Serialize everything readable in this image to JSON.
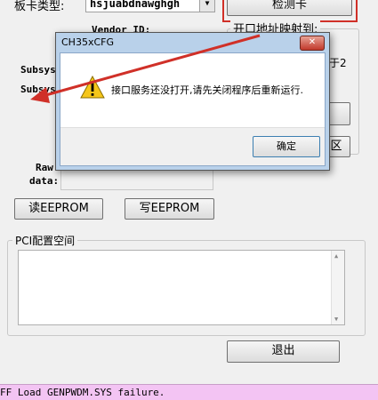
{
  "main": {
    "card_type_label": "板卡类型:",
    "card_type_value": "hsjuabdnawghgh",
    "detect_button": "检测卡",
    "vendor_id_label": "Vendor ID:",
    "subsys_label_1": "Subsys",
    "subsys_label_2": "Subsys",
    "port_map_group": "开口地址映射到:",
    "right_partial_text": "于2",
    "raw_label": "Raw",
    "data_label": "data:",
    "read_eeprom": "读EEPROM",
    "write_eeprom": "写EEPROM",
    "pci_group": "PCI配置空间",
    "exit_button": "退出",
    "partial_button_text": "区"
  },
  "dialog": {
    "title": "CH35xCFG",
    "close_glyph": "✕",
    "message": "接口服务还没打开,请先关闭程序后重新运行.",
    "ok_button": "确定",
    "icon": "warning-icon"
  },
  "status_bar": {
    "text": "FF Load GENPWDM.SYS failure."
  },
  "colors": {
    "annotation_arrow": "#d03028",
    "annotation_box": "#d03028",
    "status_bg": "#f3c4f3"
  }
}
